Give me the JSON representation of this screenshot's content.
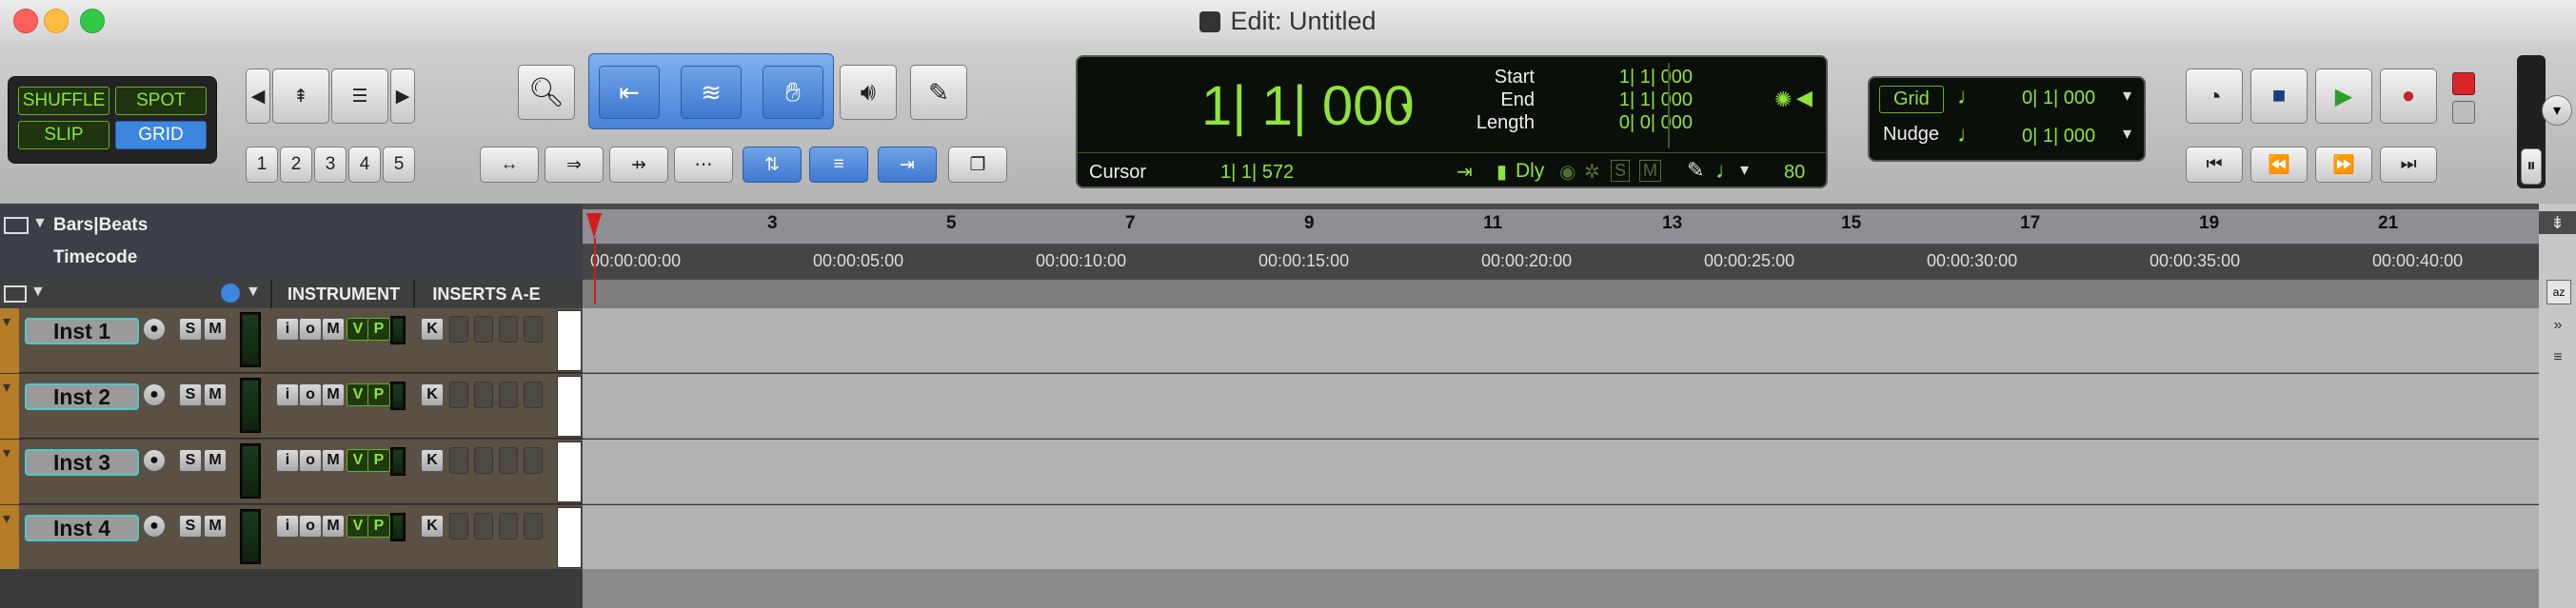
{
  "window": {
    "title": "Edit: Untitled"
  },
  "modes": {
    "shuffle": "SHUFFLE",
    "spot": "SPOT",
    "slip": "SLIP",
    "grid": "GRID"
  },
  "zoom_presets": [
    "1",
    "2",
    "3",
    "4",
    "5"
  ],
  "counter": {
    "main": "1| 1| 000",
    "start_label": "Start",
    "start_value": "1| 1| 000",
    "end_label": "End",
    "end_value": "1| 1| 000",
    "length_label": "Length",
    "length_value": "0| 0| 000",
    "cursor_label": "Cursor",
    "cursor_value": "1| 1| 572",
    "dly_label": "Dly",
    "s_label": "S",
    "m_label": "M",
    "tempo": "80"
  },
  "grid_nudge": {
    "grid_label": "Grid",
    "grid_value": "0| 1| 000",
    "nudge_label": "Nudge",
    "nudge_value": "0| 1| 000"
  },
  "rulers": {
    "bars_label": "Bars|Beats",
    "timecode_label": "Timecode",
    "bar_ticks": [
      "3",
      "5",
      "7",
      "9",
      "11",
      "13",
      "15",
      "17",
      "19",
      "21"
    ],
    "timecode_ticks": [
      "00:00:00:00",
      "00:00:05:00",
      "00:00:10:00",
      "00:00:15:00",
      "00:00:20:00",
      "00:00:25:00",
      "00:00:30:00",
      "00:00:35:00",
      "00:00:40:00"
    ]
  },
  "columns": {
    "instrument": "INSTRUMENT",
    "inserts": "INSERTS A-E"
  },
  "tracks": [
    {
      "name": "Inst 1",
      "s": "S",
      "m": "M",
      "i": "i",
      "o": "o",
      "mm": "M",
      "v": "V",
      "p": "P",
      "k": "K"
    },
    {
      "name": "Inst 2",
      "s": "S",
      "m": "M",
      "i": "i",
      "o": "o",
      "mm": "M",
      "v": "V",
      "p": "P",
      "k": "K"
    },
    {
      "name": "Inst 3",
      "s": "S",
      "m": "M",
      "i": "i",
      "o": "o",
      "mm": "M",
      "v": "V",
      "p": "P",
      "k": "K"
    },
    {
      "name": "Inst 4",
      "s": "S",
      "m": "M",
      "i": "i",
      "o": "o",
      "mm": "M",
      "v": "V",
      "p": "P",
      "k": "K"
    }
  ],
  "colors": {
    "lcd_green": "#8fe33a",
    "track_outline": "#4fc8c8",
    "accent_blue": "#3f78cf"
  }
}
